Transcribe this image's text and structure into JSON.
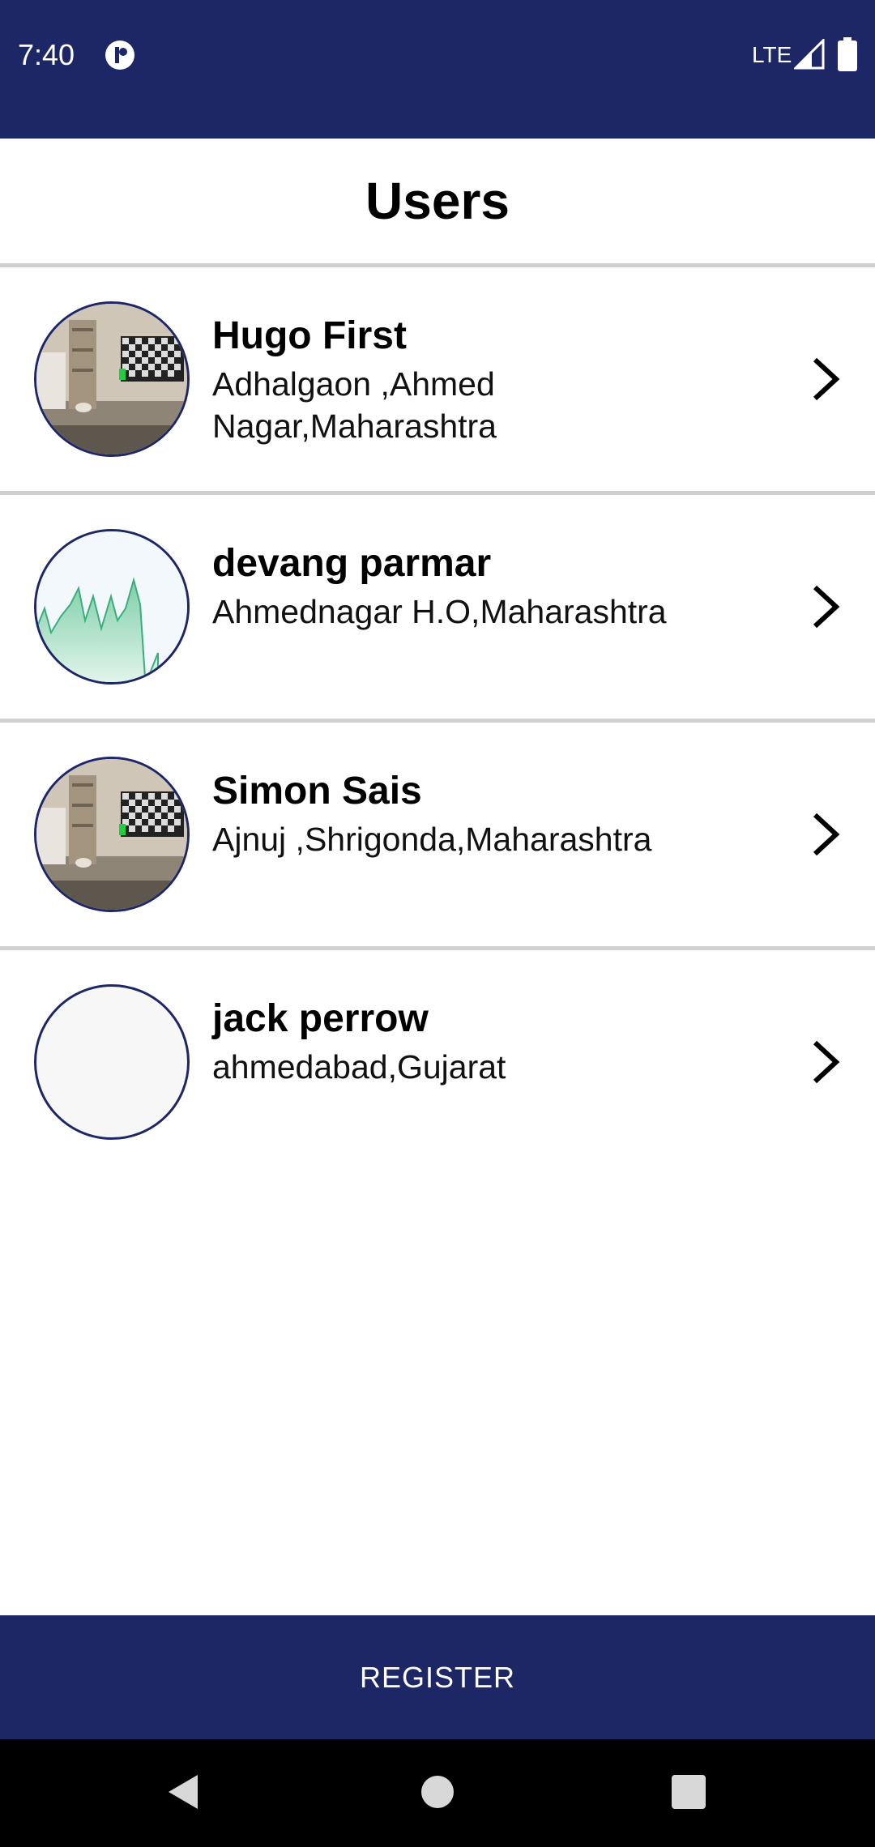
{
  "status_bar": {
    "time": "7:40",
    "network": "LTE",
    "background_color": "#1e2766",
    "app_icon": "app-notification-icon",
    "signal_icon": "signal-icon",
    "battery_icon": "battery-icon"
  },
  "header": {
    "title": "Users"
  },
  "users": [
    {
      "name": "Hugo First",
      "address": "Adhalgaon ,Ahmed Nagar,Maharashtra",
      "avatar": "room-photo"
    },
    {
      "name": "devang parmar",
      "address": "Ahmednagar H.O,Maharashtra",
      "avatar": "chart-image"
    },
    {
      "name": "Simon Sais",
      "address": "Ajnuj ,Shrigonda,Maharashtra",
      "avatar": "room-photo"
    },
    {
      "name": "jack perrow",
      "address": "ahmedabad,Gujarat",
      "avatar": "empty"
    }
  ],
  "footer": {
    "register_label": "REGISTER",
    "accent_color": "#1e2766"
  },
  "nav_bar": {
    "back_icon": "back-triangle-icon",
    "home_icon": "home-circle-icon",
    "recents_icon": "recents-square-icon"
  }
}
